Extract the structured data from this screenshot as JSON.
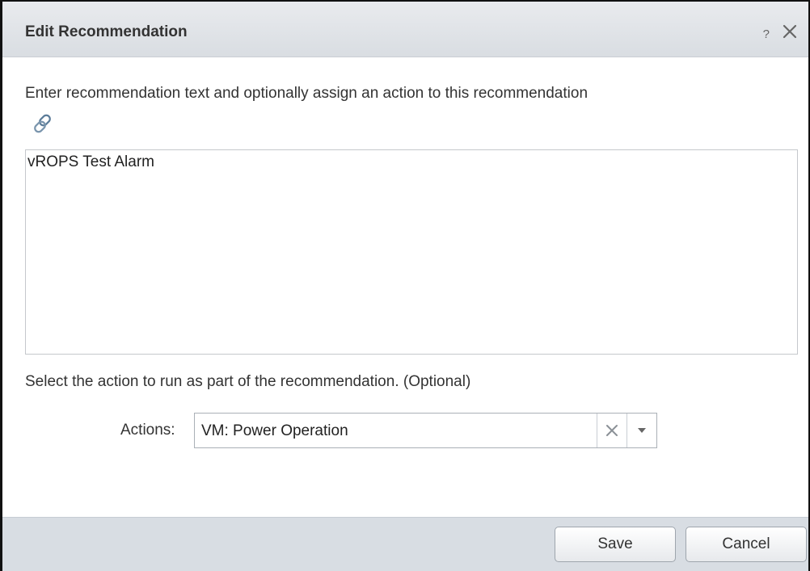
{
  "dialog": {
    "title": "Edit Recommendation",
    "help_label": "?"
  },
  "recommendation": {
    "instructions": "Enter recommendation text and optionally assign an action to this recommendation",
    "text": "vROPS Test Alarm"
  },
  "action": {
    "help_text": "Select the action to run as part of the recommendation. (Optional)",
    "label": "Actions:",
    "selected": "VM: Power Operation"
  },
  "footer": {
    "save_label": "Save",
    "cancel_label": "Cancel"
  },
  "icons": {
    "close": "close-icon",
    "link": "link-icon",
    "clear": "clear-icon",
    "dropdown": "chevron-down-icon"
  }
}
